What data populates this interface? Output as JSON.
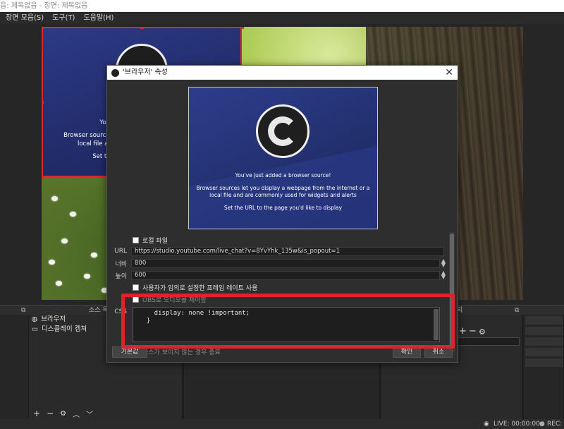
{
  "window": {
    "title": "읍: 제목없음 - 장면: 제목없음"
  },
  "menu": {
    "items": [
      "장면 모음(S)",
      "도구(T)",
      "도움말(H)"
    ]
  },
  "canvas": {
    "source_text_line1": "You've",
    "source_text_line2": "Browser sources let you",
    "source_text_line3": "local file and a",
    "source_text_line4": "Set the U"
  },
  "dialog": {
    "title": "'브라우저' 속성",
    "close_glyph": "✕",
    "preview": {
      "line1": "You've just added a browser source!",
      "line2": "Browser sources let you display a webpage from the internet or a",
      "line3": "local file and are commonly used for widgets and alerts",
      "line4": "Set the URL to the page you'd like to display"
    },
    "local_file_label": "로컬 파일",
    "url_label": "URL",
    "url_value": "https://studio.youtube.com/live_chat?v=8YvYhk_135w&is_popout=1",
    "width_label": "너비",
    "width_value": "800",
    "height_label": "높이",
    "height_value": "600",
    "custom_fps_label": "사용자가 임의로 설정한 프레임 레이트 사용",
    "obs_audio_label": "OBS로 오디오를 제어함",
    "css_label": "CSS",
    "css_value": "    display: none !important;\n  }",
    "shutdown_label": "소스가 보이지 않는 경우 종료",
    "defaults_button": "기본값",
    "ok_button": "확인",
    "cancel_button": "취소"
  },
  "docks": {
    "sources_title": "소스 목",
    "mixer_title": "믹",
    "sources": [
      {
        "icon": "globe-icon",
        "label": "브라우저"
      },
      {
        "icon": "monitor-icon",
        "label": "디스플레이 캡쳐"
      }
    ]
  },
  "statusbar": {
    "live": "LIVE: 00:00:00",
    "rec": "REC:"
  },
  "colors": {
    "accent_red": "#e0232a",
    "selection_red": "#d8292b",
    "obs_blue": "#2c3a86"
  }
}
